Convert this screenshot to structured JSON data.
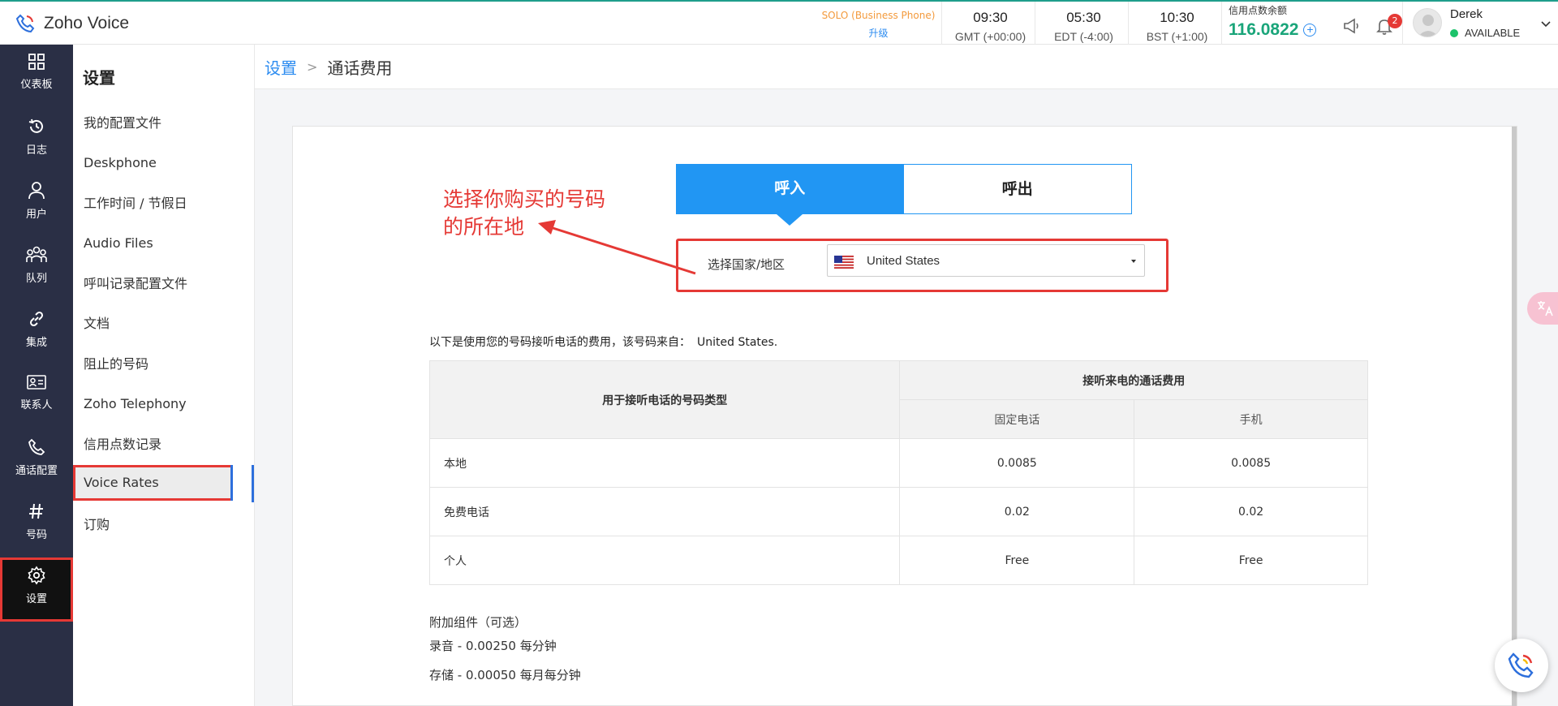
{
  "app": {
    "name": "Zoho Voice"
  },
  "plan": {
    "label": "SOLO (Business Phone)",
    "upgrade": "升级"
  },
  "clocks": [
    {
      "time": "09:30",
      "zone": "GMT (+00:00)"
    },
    {
      "time": "05:30",
      "zone": "EDT (-4:00)"
    },
    {
      "time": "10:30",
      "zone": "BST (+1:00)"
    }
  ],
  "credits": {
    "label": "信用点数余额",
    "value": "116.0822"
  },
  "notifications": {
    "count": "2"
  },
  "user": {
    "name": "Derek",
    "status": "AVAILABLE"
  },
  "nav": {
    "dashboard": "仪表板",
    "logs": "日志",
    "users": "用户",
    "queue": "队列",
    "integrations": "集成",
    "contacts": "联系人",
    "call_config": "通话配置",
    "numbers": "号码",
    "settings": "设置"
  },
  "sidebar": {
    "title": "设置",
    "items": [
      {
        "label": "我的配置文件"
      },
      {
        "label": "Deskphone"
      },
      {
        "label": "工作时间 / 节假日"
      },
      {
        "label": "Audio Files"
      },
      {
        "label": "呼叫记录配置文件"
      },
      {
        "label": "文档"
      },
      {
        "label": "阻止的号码"
      },
      {
        "label": "Zoho Telephony"
      },
      {
        "label": "信用点数记录"
      },
      {
        "label": "Voice Rates"
      },
      {
        "label": "订购"
      }
    ]
  },
  "breadcrumb": {
    "parent": "设置",
    "current": "通话费用"
  },
  "tabs": {
    "incoming": "呼入",
    "outgoing": "呼出"
  },
  "country": {
    "label": "选择国家/地区",
    "selected": "United States"
  },
  "annotation": {
    "line1": "选择你购买的号码",
    "line2": "的所在地"
  },
  "description": {
    "text": "以下是使用您的号码接听电话的费用，该号码来自：",
    "country": "United States."
  },
  "table": {
    "col_type": "用于接听电话的号码类型",
    "col_cost": "接听来电的通话费用",
    "col_landline": "固定电话",
    "col_mobile": "手机",
    "rows": [
      {
        "type": "本地",
        "landline": "0.0085",
        "mobile": "0.0085"
      },
      {
        "type": "免费电话",
        "landline": "0.02",
        "mobile": "0.02"
      },
      {
        "type": "个人",
        "landline": "Free",
        "mobile": "Free"
      }
    ]
  },
  "addons": {
    "title": "附加组件（可选）",
    "recording": "录音 - 0.00250 每分钟",
    "storage": "存储 - 0.00050 每月每分钟"
  },
  "colors": {
    "accent": "#2196f3",
    "nav_bg": "#2a2f45",
    "highlight": "#e53935",
    "credit": "#1aa57a"
  }
}
